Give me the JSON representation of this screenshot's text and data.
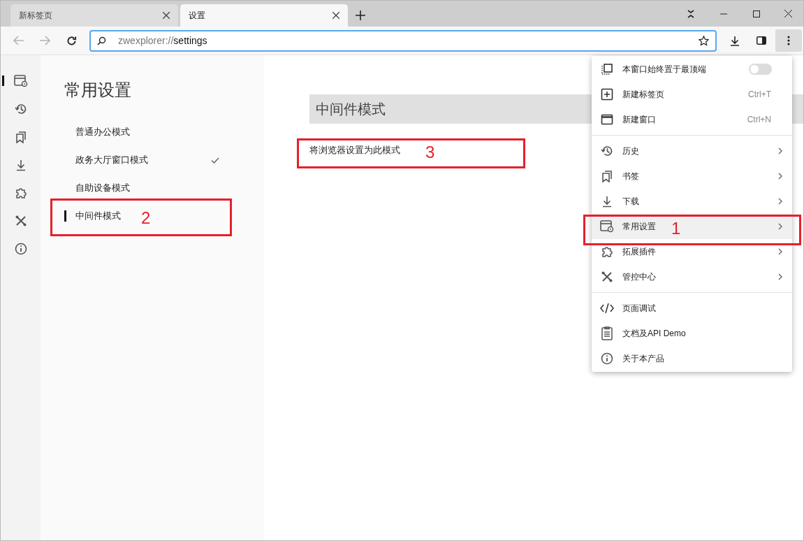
{
  "tabs": [
    {
      "title": "新标签页",
      "selected": false
    },
    {
      "title": "设置",
      "selected": true
    }
  ],
  "address_bar": {
    "scheme": "zwexplorer://",
    "path": "settings"
  },
  "rail_items": [
    {
      "kind": "settings",
      "selected": true
    },
    {
      "kind": "history",
      "selected": false
    },
    {
      "kind": "bookmarks",
      "selected": false
    },
    {
      "kind": "download",
      "selected": false
    },
    {
      "kind": "extension",
      "selected": false
    },
    {
      "kind": "tools",
      "selected": false
    },
    {
      "kind": "info",
      "selected": false
    }
  ],
  "settings_nav": {
    "title": "常用设置",
    "items": [
      {
        "label": "普通办公模式",
        "checked": false,
        "selected": false
      },
      {
        "label": "政务大厅窗口模式",
        "checked": true,
        "selected": false
      },
      {
        "label": "自助设备模式",
        "checked": false,
        "selected": false
      },
      {
        "label": "中间件模式",
        "checked": false,
        "selected": true
      }
    ]
  },
  "content": {
    "heading": "中间件模式",
    "action": "将浏览器设置为此模式"
  },
  "menu": {
    "sections": [
      [
        {
          "label": "本窗口始终置于最顶端",
          "on": false,
          "selected": false
        },
        {
          "label": "新建标签页",
          "shortcut": "Ctrl+T",
          "selected": false
        },
        {
          "label": "新建窗口",
          "shortcut": "Ctrl+N",
          "selected": false
        }
      ],
      [
        {
          "label": "历史",
          "submenu": true,
          "selected": false
        },
        {
          "label": "书签",
          "submenu": true,
          "selected": false
        },
        {
          "label": "下载",
          "submenu": true,
          "selected": false
        },
        {
          "label": "常用设置",
          "submenu": true,
          "selected": true
        },
        {
          "label": "拓展插件",
          "submenu": true,
          "selected": false
        },
        {
          "label": "管控中心",
          "submenu": true,
          "selected": false
        }
      ],
      [
        {
          "label": "页面调试",
          "selected": false
        },
        {
          "label": "文档及API Demo",
          "selected": false
        },
        {
          "label": "关于本产品",
          "selected": false
        }
      ]
    ]
  },
  "callouts": [
    {
      "label": "1"
    },
    {
      "label": "2"
    },
    {
      "label": "3"
    }
  ]
}
